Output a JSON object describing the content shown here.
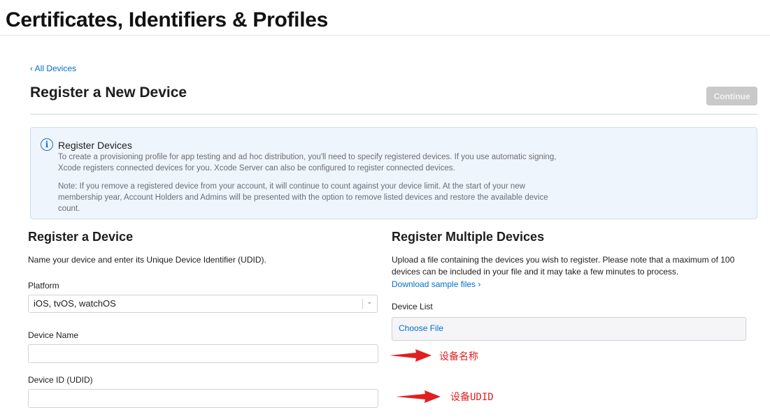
{
  "header": {
    "title": "Certificates, Identifiers & Profiles"
  },
  "nav": {
    "back_link": "‹ All Devices"
  },
  "section": {
    "title": "Register a New Device",
    "continue_label": "Continue"
  },
  "info": {
    "icon": "info-circle-icon",
    "title": "Register Devices",
    "paragraph1": "To create a provisioning profile for app testing and ad hoc distribution, you'll need to specify registered devices. If you use automatic signing, Xcode registers connected devices for you. Xcode Server can also be configured to register connected devices.",
    "paragraph2": "Note: If you remove a registered device from your account, it will continue to count against your device limit. At the start of your new membership year, Account Holders and Admins will be presented with the option to remove listed devices and restore the available device count."
  },
  "register_device": {
    "title": "Register a Device",
    "description": "Name your device and enter its Unique Device Identifier (UDID).",
    "platform_label": "Platform",
    "platform_value": "iOS, tvOS, watchOS",
    "device_name_label": "Device Name",
    "device_name_value": "",
    "device_id_label": "Device ID (UDID)",
    "device_id_value": ""
  },
  "register_multiple": {
    "title": "Register Multiple Devices",
    "description": "Upload a file containing the devices you wish to register. Please note that a maximum of 100 devices can be included in your file and it may take a few minutes to process.",
    "sample_link": "Download sample files ›",
    "device_list_label": "Device List",
    "choose_file_label": "Choose File"
  },
  "annotations": {
    "device_name_note": "设备名称",
    "udid_note": "设备UDID",
    "color": "#e02020"
  },
  "colors": {
    "accent": "#0070c9",
    "info_bg": "#eef5fc",
    "button_disabled": "#c9c9c9"
  }
}
